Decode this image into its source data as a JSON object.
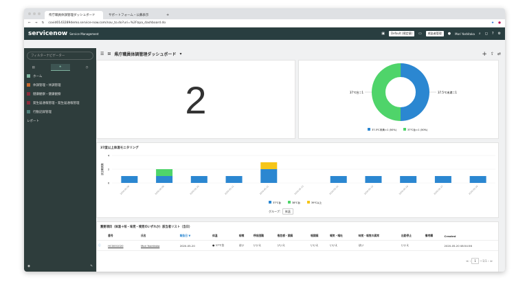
{
  "browser": {
    "tabs": [
      "県庁職員体調管理ダッシュボード",
      "サポートフォーム・公募表示"
    ],
    "url": "covid0143289demo.service-now.com/nav_to.do?uri=%2F$pa_dashboard.do"
  },
  "header": {
    "logo": "servicenow",
    "product": "Service Management",
    "domain_select": "Default (規定値)",
    "app_select": "感染者管理",
    "user": "Mori Yoshitaka"
  },
  "sidebar": {
    "filter_placeholder": "フィルターナビゲーター",
    "items": [
      {
        "label": "ホーム",
        "color": "#81b5a1"
      },
      {
        "label": "体調管理・体調管理",
        "color": "#c96a2f"
      },
      {
        "label": "健康観察・健康観察",
        "color": "#8b2b3a"
      },
      {
        "label": "発生届通報管理・発生届通報管理",
        "color": "#8b2b3a"
      },
      {
        "label": "行動記録管理",
        "color": "#4f7f7a"
      },
      {
        "label": "レポート",
        "color": ""
      }
    ]
  },
  "dashboard": {
    "title": "県庁職員体調管理ダッシュボード",
    "big_number": "2"
  },
  "pie": {
    "labels": [
      "37℃台＝1",
      "37.5℃未満＝1"
    ],
    "legend": [
      "37.5℃未満＝1 (50%)",
      "37℃台＝1 (50%)"
    ]
  },
  "chart_data": {
    "type": "bar",
    "stacked": true,
    "title": "37度以上体温モニタリング",
    "ylabel": "該当職員数",
    "ylim": [
      0,
      4
    ],
    "categories": [
      "2020-05-08",
      "2020-05-09",
      "2020-05-10",
      "2020-05-11",
      "2020-05-12",
      "2020-05-13",
      "2020-05-14",
      "2020-05-15",
      "2020-05-16",
      "2020-05-17",
      "2020-05-18"
    ],
    "series": [
      {
        "name": "37℃台",
        "color": "#2b87d1",
        "values": [
          1,
          1,
          1,
          1,
          2,
          0,
          1,
          1,
          1,
          1,
          1
        ]
      },
      {
        "name": "38℃台",
        "color": "#4fd46a",
        "values": [
          0,
          1,
          0,
          0,
          0,
          0,
          0,
          0,
          0,
          0,
          0
        ]
      },
      {
        "name": "39℃以上",
        "color": "#f5c518",
        "values": [
          0,
          0,
          0,
          0,
          1,
          0,
          0,
          0,
          0,
          0,
          0
        ]
      }
    ],
    "yticks": [
      "0",
      "2",
      "4"
    ],
    "group_label": "グループ：",
    "group_value": "体温"
  },
  "list": {
    "title": "重要項目（体温＋咳・味覚・嗅覚のいずれか）該当者リスト（当日）",
    "columns": [
      "番号",
      "氏名",
      "報告日 ▼",
      "体温",
      "咳嗽",
      "呼吸困難",
      "倦怠感・頭痛",
      "咽頭痛",
      "嘔気・嘔吐",
      "味覚・嗅覚の異常",
      "出勤停止",
      "備考欄",
      "Created"
    ],
    "rows": [
      [
        "HC0001020",
        "Mori Yoshitaka",
        "2020-05-20",
        "37℃台",
        "はい",
        "いいえ",
        "いいえ",
        "いいえ",
        "いいえ",
        "はい",
        "いいえ",
        "",
        "2020-05-20 08:54:56"
      ]
    ],
    "pager": {
      "page": "1",
      "total": "～1/1"
    }
  }
}
